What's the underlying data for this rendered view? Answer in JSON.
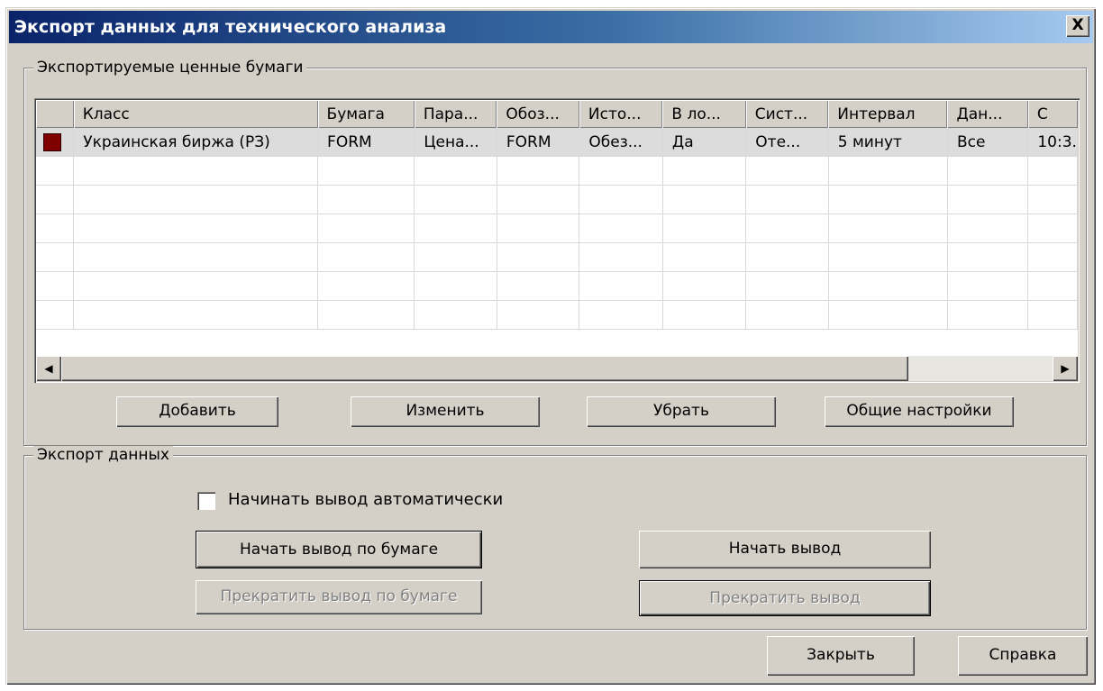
{
  "window": {
    "title": "Экспорт данных для технического анализа",
    "close_glyph": "X"
  },
  "securities": {
    "group_title": "Экспортируемые ценные бумаги",
    "columns": [
      "",
      "Класс",
      "Бумага",
      "Пара...",
      "Обоз...",
      "Исто...",
      "В ло...",
      "Сист...",
      "Интервал",
      "Дан...",
      "С"
    ],
    "rows": [
      {
        "status_color": "#800000",
        "cells": [
          "Украинская биржа (РЗ)",
          "FORM",
          "Цена...",
          "FORM",
          "Обез...",
          "Да",
          "Оте...",
          "5 минут",
          "Все",
          "10:3."
        ]
      }
    ],
    "empty_rows": 6,
    "buttons": {
      "add": "Добавить",
      "edit": "Изменить",
      "remove": "Убрать",
      "settings": "Общие настройки"
    },
    "scrollbar": {
      "left_icon": "◀",
      "right_icon": "▶"
    }
  },
  "export": {
    "group_title": "Экспорт данных",
    "auto_start_label": "Начинать вывод автоматически",
    "auto_start_checked": false,
    "start_by_security": "Начать вывод по бумаге",
    "stop_by_security": "Прекратить вывод по бумаге",
    "start_output": "Начать вывод",
    "stop_output": "Прекратить вывод"
  },
  "footer": {
    "close": "Закрыть",
    "help": "Справка"
  }
}
